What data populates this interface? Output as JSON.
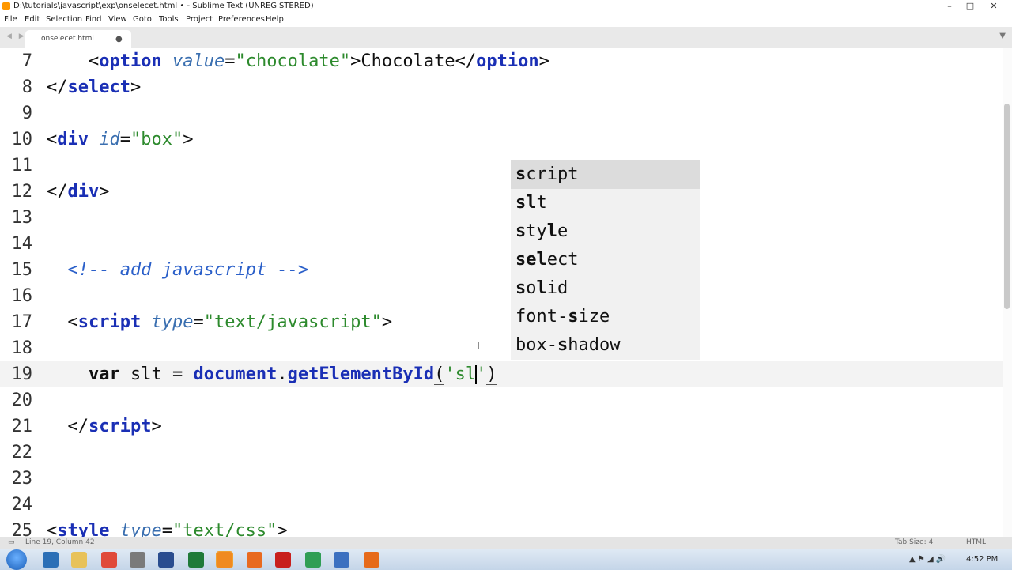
{
  "window": {
    "title": "D:\\tutorials\\javascript\\exp\\onselecet.html • - Sublime Text (UNREGISTERED)",
    "controls": [
      "–",
      "□",
      "✕"
    ]
  },
  "menu": [
    "File",
    "Edit",
    "Selection",
    "Find",
    "View",
    "Goto",
    "Tools",
    "Project",
    "Preferences",
    "Help"
  ],
  "tab": {
    "nav_arrows": "◀ ▶",
    "label": "onselecet.html",
    "dirty_dot": "●",
    "menu_icon": "▼"
  },
  "editor": {
    "line_numbers": [
      "7",
      "8",
      "9",
      "10",
      "11",
      "12",
      "13",
      "14",
      "15",
      "16",
      "17",
      "18",
      "19",
      "20",
      "21",
      "22",
      "23",
      "24",
      "25"
    ],
    "current_line": "19",
    "lines": {
      "l7": {
        "open": "<",
        "tag": "option",
        "attr": "value",
        "eq": "=",
        "str": "\"chocolate\"",
        "close": ">",
        "text": "Chocolate",
        "end_open": "</",
        "end_tag": "option",
        "end_close": ">"
      },
      "l8": {
        "open": "</",
        "tag": "select",
        "close": ">"
      },
      "l10": {
        "open": "<",
        "tag": "div",
        "attr": "id",
        "eq": "=",
        "str": "\"box\"",
        "close": ">"
      },
      "l12": {
        "open": "</",
        "tag": "div",
        "close": ">"
      },
      "l15": {
        "comment": "<!-- add javascript -->"
      },
      "l17": {
        "open": "<",
        "tag": "script",
        "attr": "type",
        "eq": "=",
        "str": "\"text/javascript\"",
        "close": ">"
      },
      "l19": {
        "kw": "var",
        "ident": " slt = ",
        "obj": "document",
        "dot": ".",
        "fn": "getElementById",
        "paren_open": "(",
        "quote_open": "'",
        "typed": "sl",
        "quote_close": "'",
        "paren_close": ")"
      },
      "l21": {
        "open": "</",
        "tag": "script",
        "close": ">"
      },
      "l25": {
        "open": "<",
        "tag": "style",
        "attr": "type",
        "eq": "=",
        "str": "\"text/css\"",
        "close": ">"
      }
    }
  },
  "autocomplete": {
    "selected_index": 0,
    "items": [
      {
        "prefix": "s",
        "rest": "cript"
      },
      {
        "prefix": "sl",
        "rest": "t"
      },
      {
        "prefix": "s",
        "mid1": "ty",
        "l": "l",
        "rest": "e"
      },
      {
        "prefix": "sel",
        "rest": "ect"
      },
      {
        "prefix": "s",
        "mid1": "o",
        "l": "l",
        "rest": "id"
      },
      {
        "before": "font-",
        "s": "s",
        "rest": "ize"
      },
      {
        "before": "box-",
        "s": "s",
        "rest": "hadow"
      }
    ]
  },
  "statusbar": {
    "position": "Line 19, Column 42",
    "tab_size": "Tab Size: 4",
    "syntax": "HTML"
  },
  "taskbar": {
    "clock": "4:52 PM",
    "tray_icons": "▲ ⚑ ◢ 🔊"
  }
}
